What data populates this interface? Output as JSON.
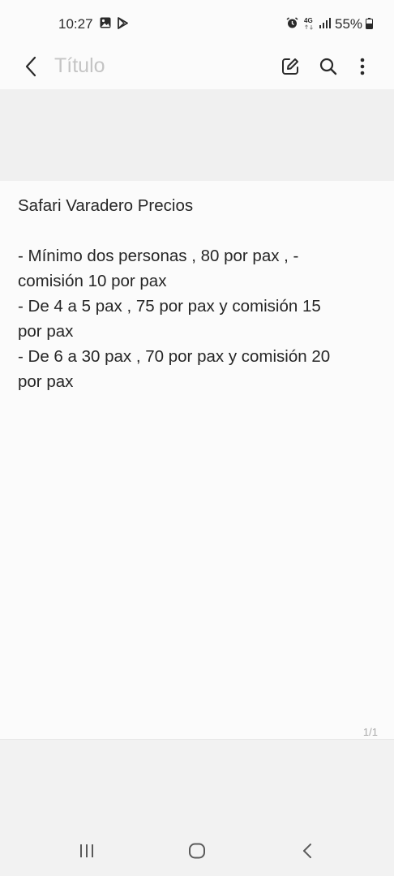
{
  "status_bar": {
    "time": "10:27",
    "battery": "55%",
    "icons": [
      "gallery-icon",
      "play-store-icon",
      "alarm-icon",
      "4g-icon",
      "signal-icon",
      "battery-icon"
    ]
  },
  "header": {
    "title_placeholder": "Título",
    "icons": [
      "back-arrow-icon",
      "edit-icon",
      "search-icon",
      "more-vertical-icon"
    ]
  },
  "note": {
    "lines": [
      "Safari Varadero Precios",
      "",
      "- Mínimo dos personas , 80 por pax , -",
      "comisión 10 por pax",
      "- De 4 a 5 pax , 75 por pax y comisión 15",
      "por pax",
      "- De 6 a 30 pax , 70 por pax y comisión 20",
      "por pax"
    ],
    "page_indicator": "1/1"
  },
  "nav_bar": {
    "icons": [
      "recent-apps-icon",
      "home-icon",
      "back-icon"
    ]
  },
  "colors": {
    "title_placeholder": "#c4c4c4",
    "note_text": "#262626",
    "banner": "#f0f0f0"
  }
}
